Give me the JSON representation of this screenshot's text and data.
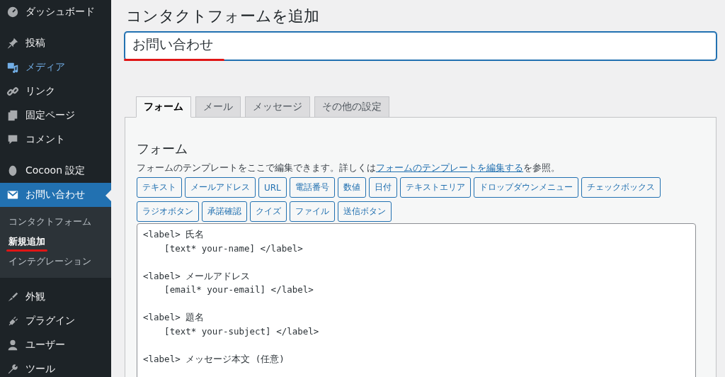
{
  "sidebar": {
    "groups": [
      {
        "items": [
          {
            "label": "ダッシュボード",
            "current": false,
            "hovered": false
          }
        ]
      },
      {
        "items": [
          {
            "label": "投稿",
            "current": false,
            "hovered": false
          },
          {
            "label": "メディア",
            "current": false,
            "hovered": true
          },
          {
            "label": "リンク",
            "current": false,
            "hovered": false
          },
          {
            "label": "固定ページ",
            "current": false,
            "hovered": false
          },
          {
            "label": "コメント",
            "current": false,
            "hovered": false
          }
        ]
      },
      {
        "items": [
          {
            "label": "Cocoon 設定",
            "current": false,
            "hovered": false
          },
          {
            "label": "お問い合わせ",
            "current": true,
            "hovered": false,
            "children": [
              {
                "label": "コンタクトフォーム",
                "selected": false,
                "underlined": false
              },
              {
                "label": "新規追加",
                "selected": true,
                "underlined": true
              },
              {
                "label": "インテグレーション",
                "selected": false,
                "underlined": false
              }
            ]
          }
        ]
      },
      {
        "items": [
          {
            "label": "外観",
            "current": false,
            "hovered": false
          },
          {
            "label": "プラグイン",
            "current": false,
            "hovered": false
          },
          {
            "label": "ユーザー",
            "current": false,
            "hovered": false
          },
          {
            "label": "ツール",
            "current": false,
            "hovered": false
          }
        ]
      }
    ]
  },
  "page": {
    "title": "コンタクトフォームを追加",
    "title_field": {
      "value": "お問い合わせ",
      "underlined": true
    },
    "tabs": [
      {
        "label": "フォーム",
        "selected": true
      },
      {
        "label": "メール",
        "selected": false
      },
      {
        "label": "メッセージ",
        "selected": false
      },
      {
        "label": "その他の設定",
        "selected": false
      }
    ],
    "panel": {
      "heading": "フォーム",
      "description": "フォームのテンプレートをここで編集できます。詳しくは",
      "link": "フォームのテンプレートを編集する",
      "description_end": "を参照。",
      "tag_buttons": [
        "テキスト",
        "メールアドレス",
        "URL",
        "電話番号",
        "数値",
        "日付",
        "テキストエリア",
        "ドロップダウンメニュー",
        "チェックボックス",
        "ラジオボタン",
        "承諾確認",
        "クイズ",
        "ファイル",
        "送信ボタン"
      ],
      "code_blocks": [
        {
          "lines": [
            "<label> 氏名",
            "    [text* your-name] </label>"
          ]
        },
        {
          "lines": [
            "<label> メールアドレス",
            "    [email* your-email] </label>"
          ]
        },
        {
          "lines": [
            "<label> 題名",
            "    [text* your-subject] </label>"
          ]
        },
        {
          "lines": [
            "<label> メッセージ本文 (任意)"
          ]
        }
      ]
    }
  }
}
